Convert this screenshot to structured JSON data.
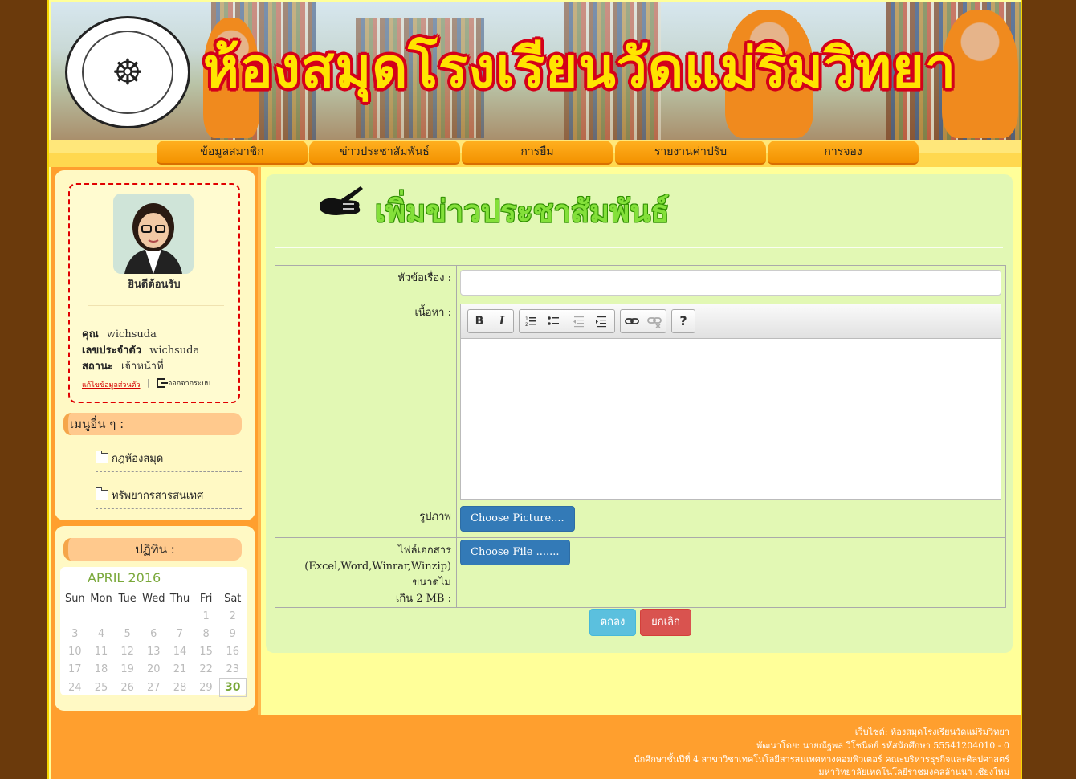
{
  "banner": {
    "title": "ห้องสมุดโรงเรียนวัดแม่ริมวิทยา"
  },
  "nav": [
    "ข้อมูลสมาชิก",
    "ข่าวประชาสัมพันธ์",
    "การยืม",
    "รายงานค่าปรับ",
    "การจอง"
  ],
  "profile": {
    "welcome": "ยินดีต้อนรับ",
    "name_label": "คุณ",
    "name_value": "wichsuda",
    "id_label": "เลขประจำตัว",
    "id_value": "wichsuda",
    "status_label": "สถานะ",
    "status_value": "เจ้าหน้าที่",
    "edit_link": "แก้ไขข้อมูลส่วนตัว",
    "separator": "|",
    "logout_label": "ออกจากระบบ"
  },
  "other_menu": {
    "heading": "เมนูอื่น ๆ :",
    "items": [
      "กฎห้องสมุด",
      "ทรัพยากรสารสนเทศ"
    ]
  },
  "calendar": {
    "heading": "ปฏิทิน :",
    "month": "APRIL 2016",
    "days": [
      "Sun",
      "Mon",
      "Tue",
      "Wed",
      "Thu",
      "Fri",
      "Sat"
    ],
    "weeks": [
      [
        "",
        "",
        "",
        "",
        "",
        "1",
        "2"
      ],
      [
        "3",
        "4",
        "5",
        "6",
        "7",
        "8",
        "9"
      ],
      [
        "10",
        "11",
        "12",
        "13",
        "14",
        "15",
        "16"
      ],
      [
        "17",
        "18",
        "19",
        "20",
        "21",
        "22",
        "23"
      ],
      [
        "24",
        "25",
        "26",
        "27",
        "28",
        "29",
        "30"
      ]
    ],
    "today": "30"
  },
  "form": {
    "title": "เพิ่มข่าวประชาสัมพันธ์",
    "subject_label": "หัวข้อเรื่อง :",
    "subject_value": "",
    "content_label": "เนื้อหา :",
    "picture_label": "รูปภาพ",
    "picture_button": "Choose Picture....",
    "file_label_1": "ไฟล์เอกสาร",
    "file_label_2": "(Excel,Word,Winrar,Winzip) ขนาดไม่",
    "file_label_3": "เกิน 2 MB :",
    "file_button": "Choose File .......",
    "ok_button": "ตกลง",
    "cancel_button": "ยกเลิก",
    "toolbar": {
      "bold": "B",
      "italic": "I",
      "help": "?"
    }
  },
  "footer": {
    "line1": "เว็บไซต์: ห้องสมุดโรงเรียนวัดแม่ริมวิทยา",
    "line2": "พัฒนาโดย: นายณัฐพล วิโชนิตย์ รหัสนักศึกษา 55541204010 - 0",
    "line3": "นักศึกษาชั้นปีที่ 4 สาขาวิชาเทคโนโลยีสารสนเทศทางคอมพิวเตอร์ คณะบริหารธุรกิจและศิลปศาสตร์",
    "line4": "มหาวิทยาลัยเทคโนโลยีราชมงคลล้านนา เชียงใหม่"
  }
}
